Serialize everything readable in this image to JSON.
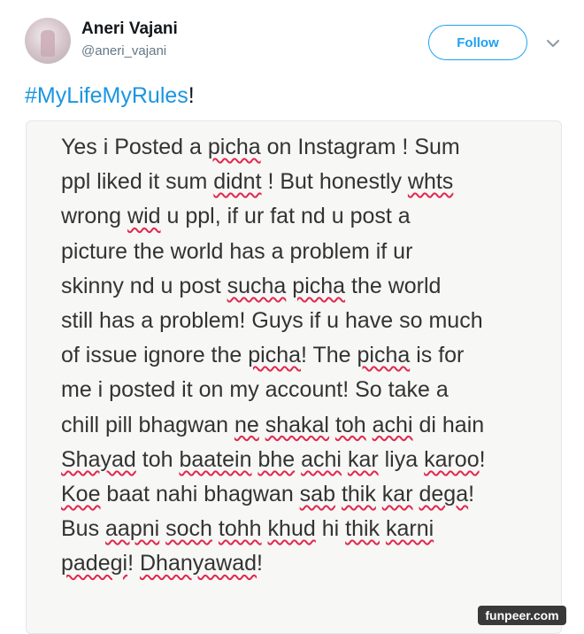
{
  "user": {
    "name": "Aneri Vajani",
    "handle": "@aneri_vajani"
  },
  "follow_label": "Follow",
  "tweet": {
    "hashtag": "#MyLifeMyRules",
    "suffix": "!"
  },
  "note_lines": [
    [
      {
        "t": "Yes i Posted a "
      },
      {
        "t": "picha",
        "s": true
      },
      {
        "t": " on Instagram ! Sum"
      }
    ],
    [
      {
        "t": "ppl liked it sum "
      },
      {
        "t": "didnt",
        "s": true
      },
      {
        "t": " ! But honestly "
      },
      {
        "t": "whts",
        "s": true
      }
    ],
    [
      {
        "t": "wrong "
      },
      {
        "t": "wid",
        "s": true
      },
      {
        "t": " u ppl, if ur fat nd u post a"
      }
    ],
    [
      {
        "t": "picture the world has a problem if ur"
      }
    ],
    [
      {
        "t": "skinny nd u post "
      },
      {
        "t": "sucha",
        "s": true
      },
      {
        "t": " "
      },
      {
        "t": "picha",
        "s": true
      },
      {
        "t": " the world"
      }
    ],
    [
      {
        "t": "still has a problem! Guys if u have so much"
      }
    ],
    [
      {
        "t": "of issue ignore the "
      },
      {
        "t": "picha",
        "s": true
      },
      {
        "t": "! The "
      },
      {
        "t": "picha",
        "s": true
      },
      {
        "t": " is for"
      }
    ],
    [
      {
        "t": "me i posted it on my account! So take a"
      }
    ],
    [
      {
        "t": "chill pill bhagwan "
      },
      {
        "t": "ne",
        "s": true
      },
      {
        "t": " "
      },
      {
        "t": "shakal",
        "s": true
      },
      {
        "t": " "
      },
      {
        "t": "toh",
        "s": true
      },
      {
        "t": " "
      },
      {
        "t": "achi",
        "s": true
      },
      {
        "t": " di hain"
      }
    ],
    [
      {
        "t": "Shayad",
        "s": true
      },
      {
        "t": " toh "
      },
      {
        "t": "baatein",
        "s": true
      },
      {
        "t": " "
      },
      {
        "t": "bhe",
        "s": true
      },
      {
        "t": " "
      },
      {
        "t": "achi",
        "s": true
      },
      {
        "t": " "
      },
      {
        "t": "kar",
        "s": true
      },
      {
        "t": " liya "
      },
      {
        "t": "karoo",
        "s": true
      },
      {
        "t": "!"
      }
    ],
    [
      {
        "t": "Koe",
        "s": true
      },
      {
        "t": " baat nahi bhagwan "
      },
      {
        "t": "sab",
        "s": true
      },
      {
        "t": " "
      },
      {
        "t": "thik",
        "s": true
      },
      {
        "t": " "
      },
      {
        "t": "kar",
        "s": true
      },
      {
        "t": " "
      },
      {
        "t": "dega",
        "s": true
      },
      {
        "t": "!"
      }
    ],
    [
      {
        "t": "Bus "
      },
      {
        "t": "aapni",
        "s": true
      },
      {
        "t": " "
      },
      {
        "t": "soch",
        "s": true
      },
      {
        "t": " "
      },
      {
        "t": "tohh",
        "s": true
      },
      {
        "t": " "
      },
      {
        "t": "khud",
        "s": true
      },
      {
        "t": " hi "
      },
      {
        "t": "thik",
        "s": true
      },
      {
        "t": " "
      },
      {
        "t": "karni",
        "s": true
      }
    ],
    [
      {
        "t": "padegi",
        "s": true
      },
      {
        "t": "! "
      },
      {
        "t": "Dhanyawad",
        "s": true
      },
      {
        "t": "!"
      }
    ]
  ],
  "watermark": "funpeer.com",
  "colors": {
    "accent": "#1da1f2",
    "hashtag": "#1b95e0",
    "spellcheck": "#e0284e"
  },
  "icons": [
    "avatar",
    "chevron-down-icon"
  ]
}
